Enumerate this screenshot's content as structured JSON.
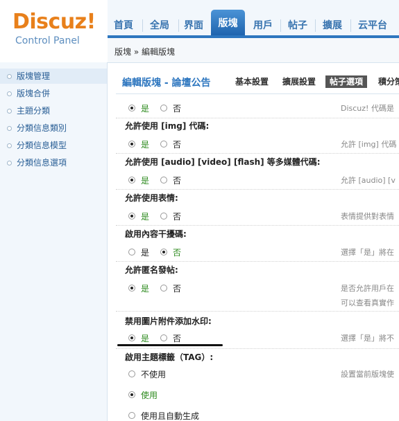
{
  "logo": {
    "main": "Discuz!",
    "sub": "Control Panel"
  },
  "nav": {
    "tabs": [
      "首頁",
      "全局",
      "界面",
      "版塊",
      "用戶",
      "帖子",
      "擴展",
      "云平台"
    ],
    "active_index": 3
  },
  "breadcrumb": "版塊 » 編輯版塊",
  "sidebar": {
    "items": [
      "版塊管理",
      "版塊合併",
      "主題分類",
      "分類信息類別",
      "分類信息模型",
      "分類信息選項"
    ],
    "active_index": 0
  },
  "main": {
    "title": "編輯版塊 - 論壇公告",
    "tabs": [
      "基本設置",
      "擴展設置",
      "帖子選項",
      "積分策"
    ],
    "active_tab_index": 2
  },
  "settings": [
    {
      "title": "",
      "options": [
        "是",
        "否"
      ],
      "selected": 0,
      "desc": [
        "Discuz! 代碼是"
      ]
    },
    {
      "title": "允許使用 [img] 代碼:",
      "options": [
        "是",
        "否"
      ],
      "selected": 0,
      "desc": [
        "允許 [img] 代碼"
      ]
    },
    {
      "title": "允許使用 [audio] [video] [flash] 等多媒體代碼:",
      "options": [
        "是",
        "否"
      ],
      "selected": 0,
      "desc": [
        "允許 [audio] [v"
      ]
    },
    {
      "title": "允許使用表情:",
      "options": [
        "是",
        "否"
      ],
      "selected": 0,
      "desc": [
        "表情提供對表情"
      ]
    },
    {
      "title": "啟用內容干擾碼:",
      "options": [
        "是",
        "否"
      ],
      "selected": 1,
      "desc": [
        "選擇「是」將在"
      ]
    },
    {
      "title": "允許匿名發帖:",
      "options": [
        "是",
        "否"
      ],
      "selected": 0,
      "desc": [
        "是否允許用戶在",
        "可以查看真實作"
      ]
    },
    {
      "title": "禁用圖片附件添加水印:",
      "options": [
        "是",
        "否"
      ],
      "selected": 0,
      "desc": [
        "選擇「是」將不"
      ]
    },
    {
      "title": "啟用主題標籤（TAG）:",
      "options": [
        "不使用",
        "使用",
        "使用且自動生成"
      ],
      "selected": 1,
      "desc": [
        "設置當前版塊使"
      ]
    }
  ]
}
